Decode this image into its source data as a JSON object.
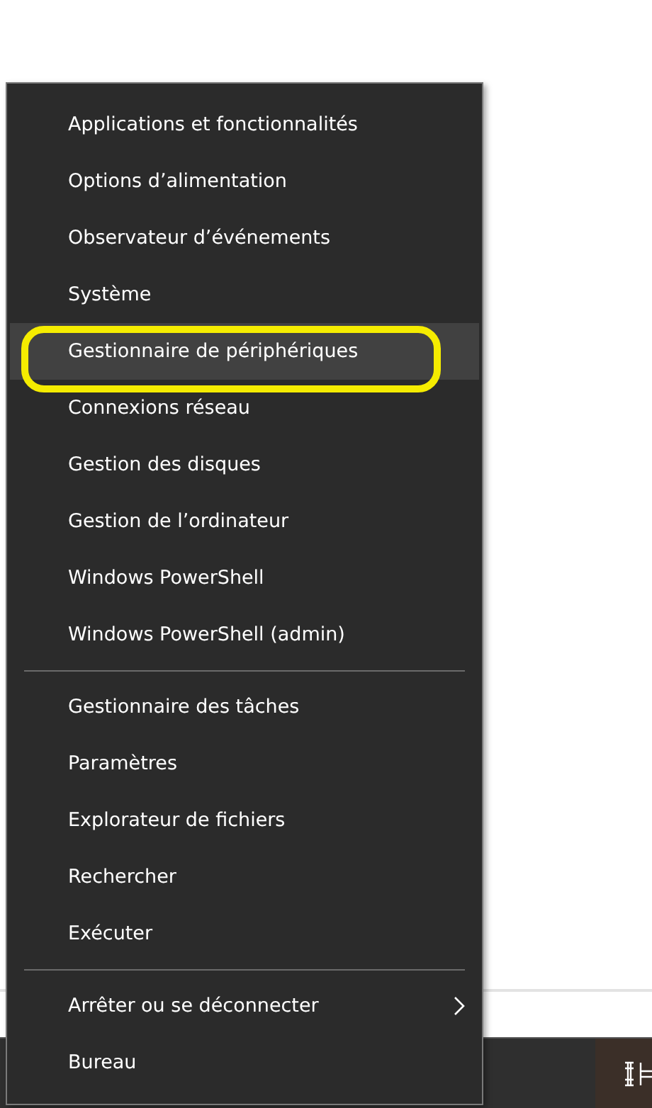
{
  "menu": {
    "items": [
      {
        "kind": "item",
        "label": "Applications et fonctionnalités",
        "selected": false,
        "circled": false,
        "submenu": false
      },
      {
        "kind": "item",
        "label": "Options d’alimentation",
        "selected": false,
        "circled": false,
        "submenu": false
      },
      {
        "kind": "item",
        "label": "Observateur d’événements",
        "selected": false,
        "circled": false,
        "submenu": false
      },
      {
        "kind": "item",
        "label": "Système",
        "selected": false,
        "circled": false,
        "submenu": false
      },
      {
        "kind": "item",
        "label": "Gestionnaire de périphériques",
        "selected": true,
        "circled": true,
        "submenu": false
      },
      {
        "kind": "item",
        "label": "Connexions réseau",
        "selected": false,
        "circled": false,
        "submenu": false
      },
      {
        "kind": "item",
        "label": "Gestion des disques",
        "selected": false,
        "circled": false,
        "submenu": false
      },
      {
        "kind": "item",
        "label": "Gestion de l’ordinateur",
        "selected": false,
        "circled": false,
        "submenu": false
      },
      {
        "kind": "item",
        "label": "Windows PowerShell",
        "selected": false,
        "circled": false,
        "submenu": false
      },
      {
        "kind": "item",
        "label": "Windows PowerShell (admin)",
        "selected": false,
        "circled": false,
        "submenu": false
      },
      {
        "kind": "separator"
      },
      {
        "kind": "item",
        "label": "Gestionnaire des tâches",
        "selected": false,
        "circled": false,
        "submenu": false
      },
      {
        "kind": "item",
        "label": "Paramètres",
        "selected": false,
        "circled": false,
        "submenu": false
      },
      {
        "kind": "item",
        "label": "Explorateur de fichiers",
        "selected": false,
        "circled": false,
        "submenu": false
      },
      {
        "kind": "item",
        "label": "Rechercher",
        "selected": false,
        "circled": false,
        "submenu": false
      },
      {
        "kind": "item",
        "label": "Exécuter",
        "selected": false,
        "circled": false,
        "submenu": false
      },
      {
        "kind": "separator"
      },
      {
        "kind": "item",
        "label": "Arrêter ou se déconnecter",
        "selected": false,
        "circled": false,
        "submenu": true
      },
      {
        "kind": "item",
        "label": "Bureau",
        "selected": false,
        "circled": false,
        "submenu": false
      }
    ]
  }
}
